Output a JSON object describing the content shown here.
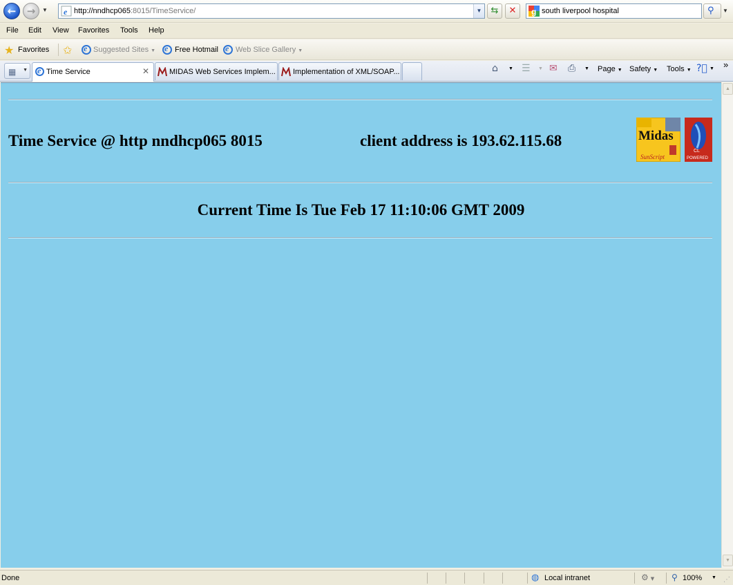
{
  "browser": {
    "address_url_host": "http://nndhcp065",
    "address_url_rest": ":8015/TimeService/",
    "search_query": "south liverpool hospital"
  },
  "menu": {
    "file": "File",
    "edit": "Edit",
    "view": "View",
    "favorites": "Favorites",
    "tools": "Tools",
    "help": "Help"
  },
  "favorites_bar": {
    "favorites_label": "Favorites",
    "suggested_sites": "Suggested Sites",
    "free_hotmail": "Free Hotmail",
    "web_slice_gallery": "Web Slice Gallery"
  },
  "tabs": [
    {
      "label": "Time Service",
      "active": true
    },
    {
      "label": "MIDAS Web Services Implem...",
      "active": false
    },
    {
      "label": "Implementation of XML/SOAP...",
      "active": false
    }
  ],
  "command_bar": {
    "page": "Page",
    "safety": "Safety",
    "tools": "Tools",
    "overflow": "»"
  },
  "content": {
    "service_title": "Time Service @ http nndhcp065 8015",
    "client_address": "client address is 193.62.115.68",
    "current_time": "Current Time Is Tue Feb 17 11:10:06 GMT 2009",
    "background_color": "#87ceeb",
    "logo_midas_text": "Midas",
    "logo_midas_sub": "SunScript",
    "logo_cl_text": "CL",
    "logo_cl_sub": "POWERED"
  },
  "status_bar": {
    "status": "Done",
    "zone": "Local intranet",
    "zoom": "100%"
  }
}
